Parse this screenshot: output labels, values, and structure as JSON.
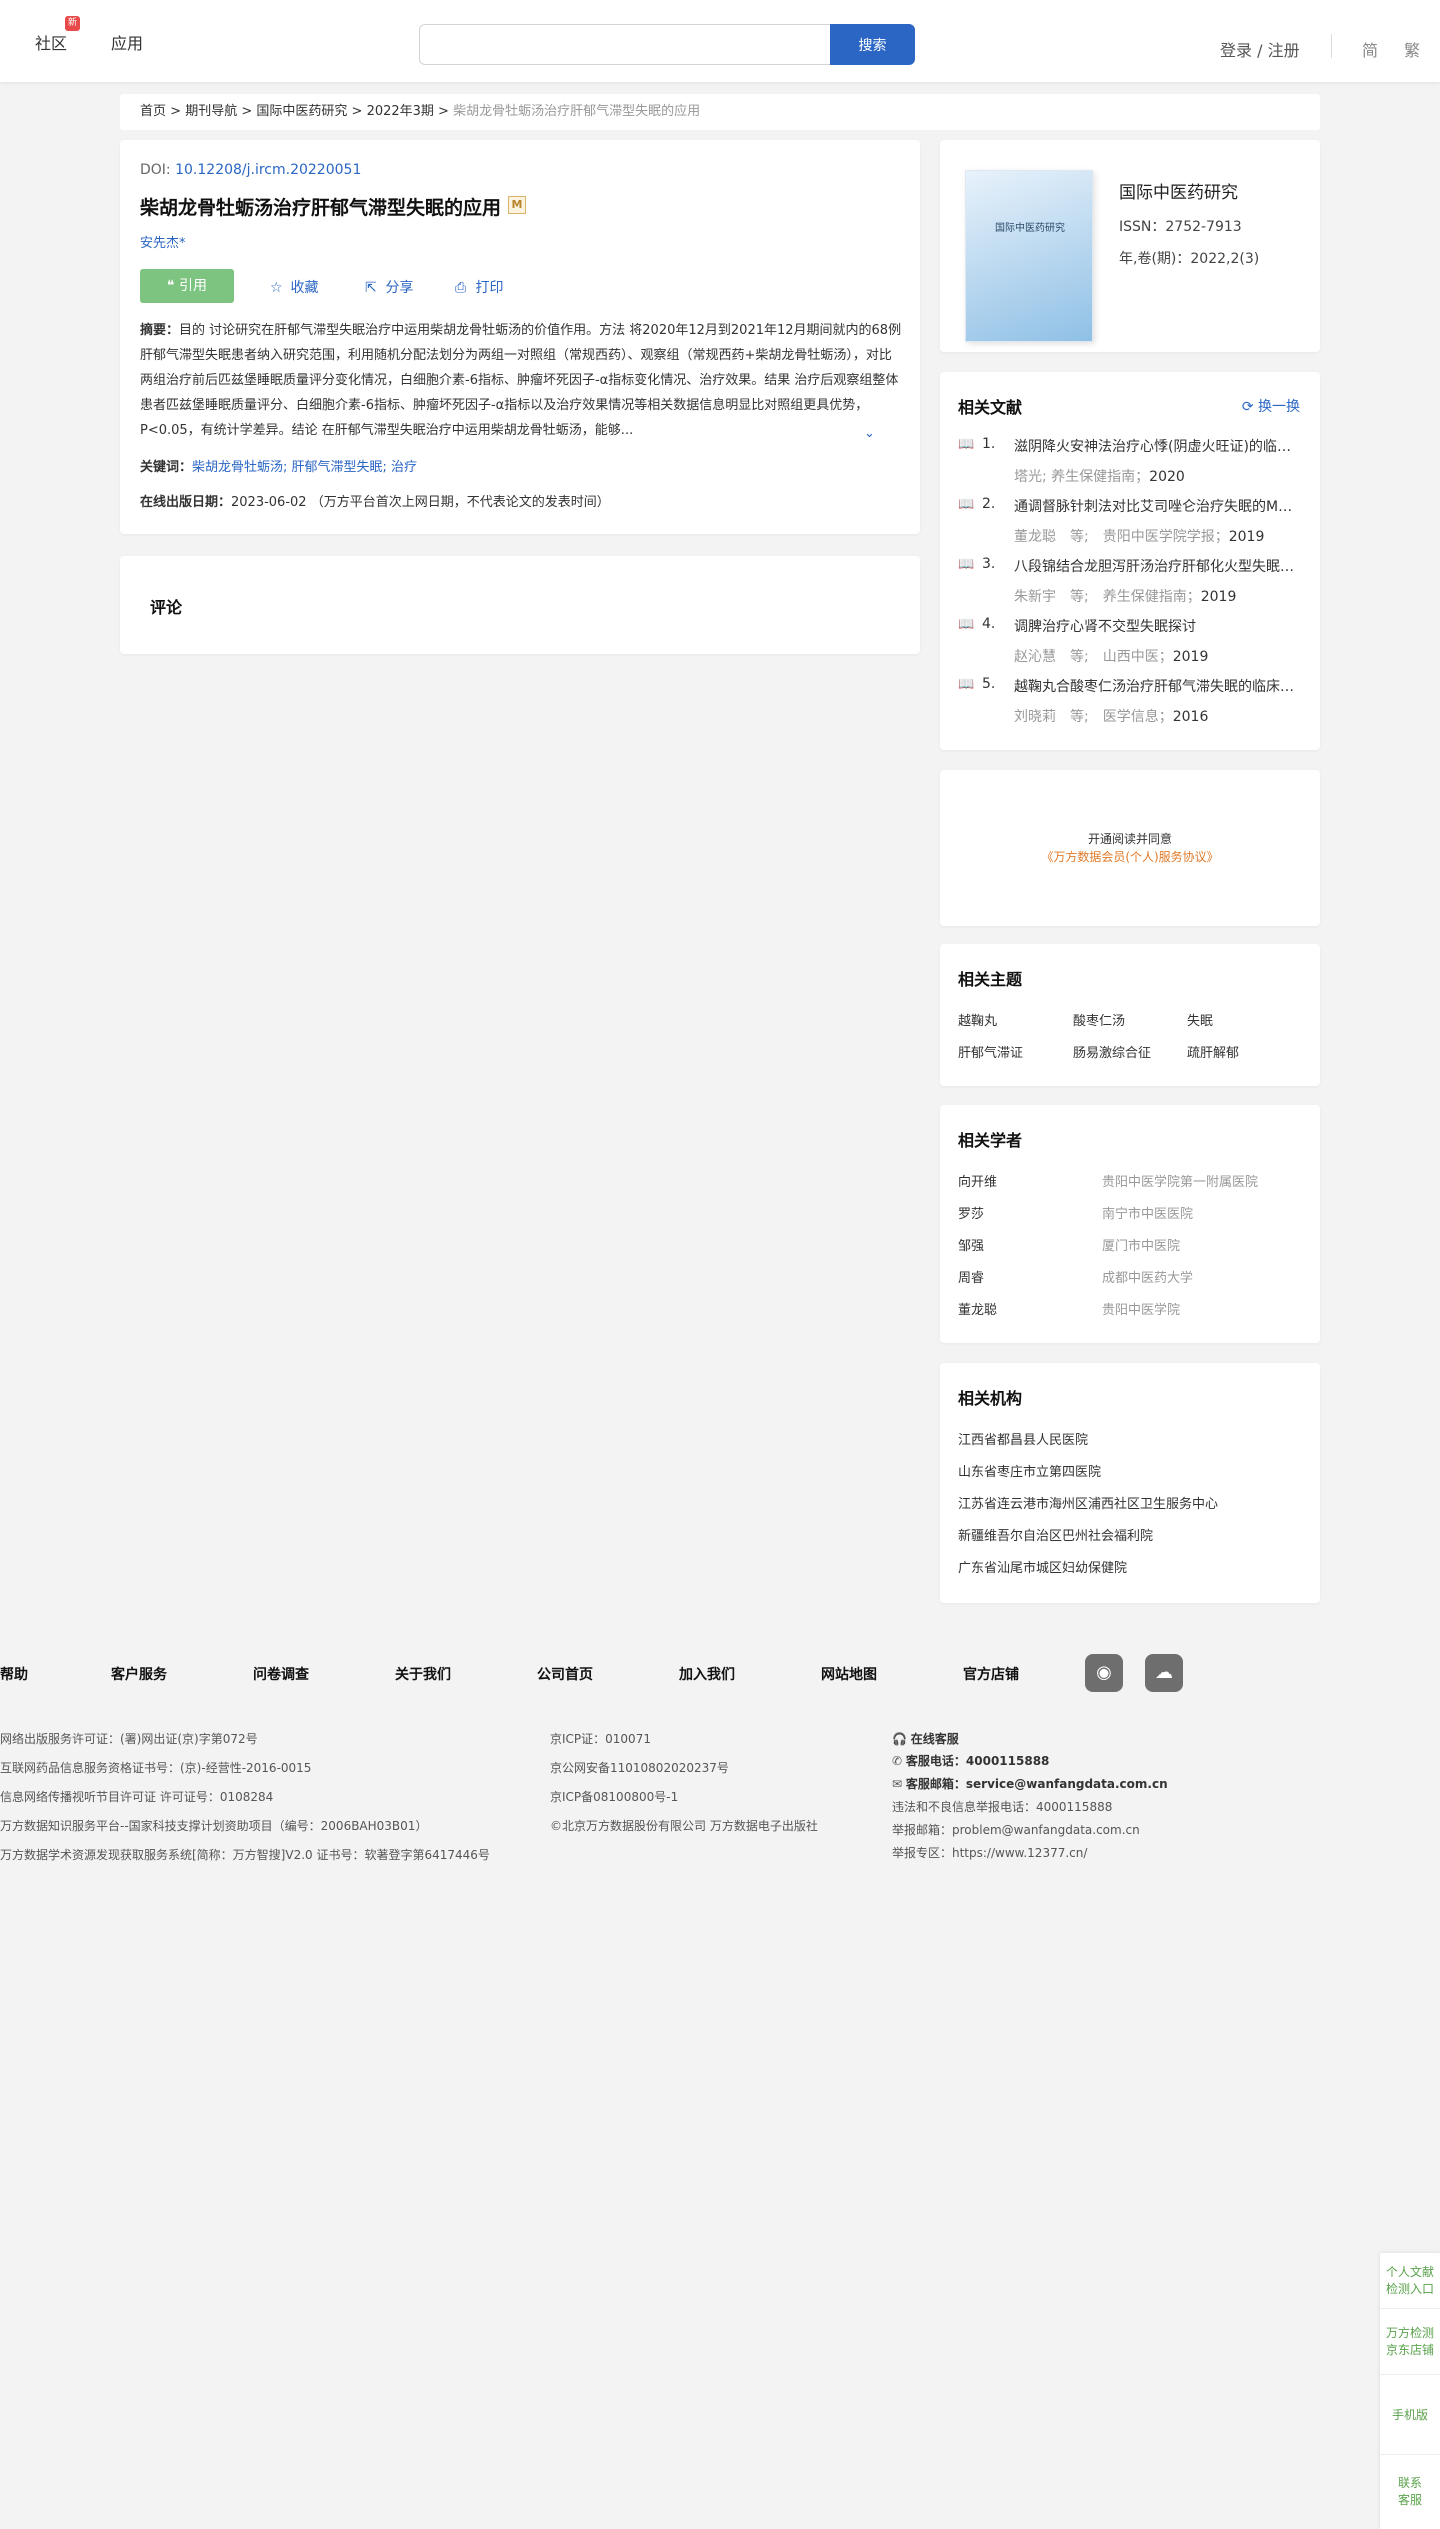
{
  "header": {
    "nav": [
      "社区",
      "应用"
    ],
    "badge": "新",
    "search": {
      "placeholder": "",
      "button": "搜索"
    },
    "login": "登录 / 注册",
    "lang": [
      "简",
      "繁"
    ]
  },
  "breadcrumb": {
    "items": [
      "首页",
      "期刊导航",
      "国际中医药研究",
      "2022年3期"
    ],
    "sep": " > ",
    "current": "柴胡龙骨牡蛎汤治疗肝郁气滞型失眠的应用"
  },
  "article": {
    "doi_label": "DOI: ",
    "doi": "10.12208/j.ircm.20220051",
    "title": "柴胡龙骨牡蛎汤治疗肝郁气滞型失眠的应用",
    "m_badge": "M",
    "author": "安先杰*",
    "actions": {
      "cite": "引用",
      "favorite": "收藏",
      "share": "分享",
      "print": "打印"
    },
    "abstract_label": "摘要：",
    "abstract": "目的 讨论研究在肝郁气滞型失眠治疗中运用柴胡龙骨牡蛎汤的价值作用。方法 将2020年12月到2021年12月期间就内的68例肝郁气滞型失眠患者纳入研究范围，利用随机分配法划分为两组一对照组（常规西药）、观察组（常规西药+柴胡龙骨牡蛎汤），对比两组治疗前后匹兹堡睡眠质量评分变化情况，白细胞介素-6指标、肿瘤坏死因子-α指标变化情况、治疗效果。结果 治疗后观察组整体患者匹兹堡睡眠质量评分、白细胞介素-6指标、肿瘤坏死因子-α指标以及治疗效果情况等相关数据信息明显比对照组更具优势，P<0.05，有统计学差异。结论 在肝郁气滞型失眠治疗中运用柴胡龙骨牡蛎汤，能够...",
    "expand_icon": "chevron-down-icon",
    "keywords_label": "关键词：",
    "keywords": "柴胡龙骨牡蛎汤; 肝郁气滞型失眠; 治疗",
    "pubdate_label": "在线出版日期：",
    "pubdate": "2023-06-02 （万方平台首次上网日期，不代表论文的发表时间）"
  },
  "comments": {
    "title": "评论"
  },
  "journal": {
    "cover_title": "国际中医药研究",
    "name": "国际中医药研究",
    "issn": "ISSN：2752-7913",
    "year": "年,卷(期)：2022,2(3)"
  },
  "related_docs": {
    "title": "相关文献",
    "refresh": "换一换",
    "items": [
      {
        "num": "1.",
        "title": "滋阴降火安神法治疗心悸(阴虚火旺证)的临床疗效观察",
        "meta": "塔光; 养生保健指南；",
        "year": "2020"
      },
      {
        "num": "2.",
        "title": "通调督脉针刺法对比艾司唑仑治疗失眠的Meta分析",
        "meta": "董龙聪　等;　贵阳中医学院学报；",
        "year": "2019"
      },
      {
        "num": "3.",
        "title": "八段锦结合龙胆泻肝汤治疗肝郁化火型失眠的临床研究",
        "meta": "朱新宇　等;　养生保健指南；",
        "year": "2019"
      },
      {
        "num": "4.",
        "title": "调脾治疗心肾不交型失眠探讨",
        "meta": "赵沁慧　等;　山西中医；",
        "year": "2019"
      },
      {
        "num": "5.",
        "title": "越鞠丸合酸枣仁汤治疗肝郁气滞失眠的临床观察",
        "meta": "刘晓莉　等;　医学信息；",
        "year": "2016"
      }
    ]
  },
  "vip": {
    "line1": "开通阅读并同意",
    "line2": "《万方数据会员(个人)服务协议》"
  },
  "topics": {
    "title": "相关主题",
    "items": [
      "越鞠丸",
      "酸枣仁汤",
      "失眠",
      "肝郁气滞证",
      "肠易激综合征",
      "疏肝解郁"
    ]
  },
  "scholars": {
    "title": "相关学者",
    "items": [
      {
        "name": "向开维",
        "org": "贵阳中医学院第一附属医院"
      },
      {
        "name": "罗莎",
        "org": "南宁市中医医院"
      },
      {
        "name": "邹强",
        "org": "厦门市中医院"
      },
      {
        "name": "周睿",
        "org": "成都中医药大学"
      },
      {
        "name": "董龙聪",
        "org": "贵阳中医学院"
      }
    ]
  },
  "institutions": {
    "title": "相关机构",
    "items": [
      "江西省都昌县人民医院",
      "山东省枣庄市立第四医院",
      "江苏省连云港市海州区浦西社区卫生服务中心",
      "新疆维吾尔自治区巴州社会福利院",
      "广东省汕尾市城区妇幼保健院"
    ]
  },
  "footer": {
    "links": [
      "帮助",
      "客户服务",
      "问卷调查",
      "关于我们",
      "公司首页",
      "加入我们",
      "网站地图",
      "官方店铺"
    ],
    "social": [
      "weibo-icon",
      "wechat-icon"
    ],
    "col1": [
      "网络出版服务许可证：(署)网出证(京)字第072号",
      "互联网药品信息服务资格证书号：(京)-经营性-2016-0015",
      "信息网络传播视听节目许可证 许可证号：0108284",
      "万方数据知识服务平台--国家科技支撑计划资助项目（编号：2006BAH03B01）",
      "万方数据学术资源发现获取服务系统[简称：万方智搜]V2.0 证书号：软著登字第6417446号"
    ],
    "col2": [
      "京ICP证：010071",
      "京公网安备11010802020237号",
      "京ICP备08100800号-1",
      "©北京万方数据股份有限公司 万方数据电子出版社"
    ],
    "service_online": "在线客服",
    "service_phone_label": "客服电话：",
    "service_phone": "4000115888",
    "service_email_label": "客服邮箱：",
    "service_email": "service@wanfangdata.com.cn",
    "report_phone": "违法和不良信息举报电话：4000115888",
    "report_email": "举报邮箱：problem@wanfangdata.com.cn",
    "report_zone": "举报专区：https://www.12377.cn/"
  },
  "float": [
    {
      "l1": "个人文献",
      "l2": "检测入口"
    },
    {
      "l1": "万方检测",
      "l2": "京东店铺"
    },
    {
      "l1": "手机版",
      "l2": ""
    },
    {
      "l1": "联系",
      "l2": "客服"
    }
  ]
}
